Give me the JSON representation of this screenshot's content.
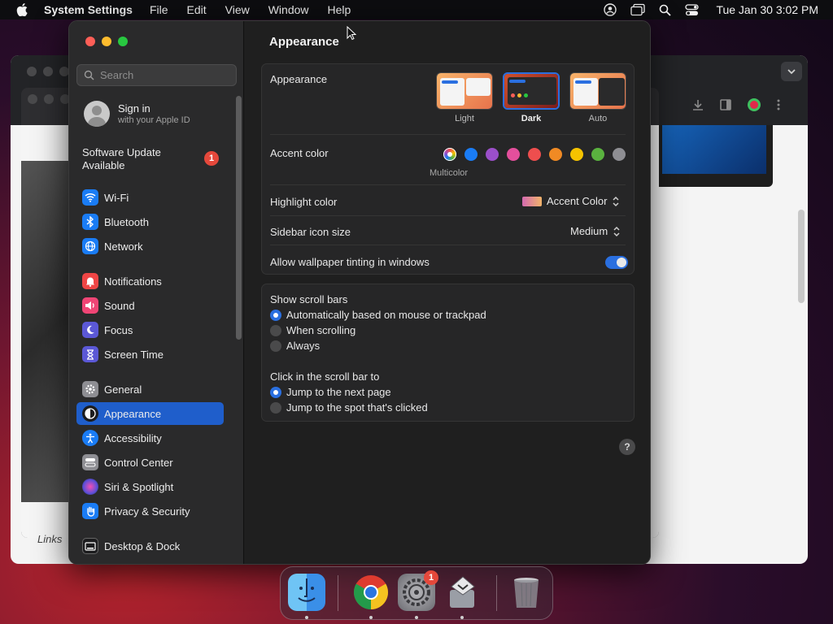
{
  "menubar": {
    "app_name": "System Settings",
    "menus": [
      "File",
      "Edit",
      "View",
      "Window",
      "Help"
    ],
    "clock": "Tue Jan 30  3:02 PM"
  },
  "background": {
    "links_text": "Links"
  },
  "sidebar": {
    "search_placeholder": "Search",
    "signin_title": "Sign in",
    "signin_subtitle": "with your Apple ID",
    "software_update_line1": "Software Update",
    "software_update_line2": "Available",
    "software_update_badge": "1",
    "items": [
      {
        "label": "Wi-Fi",
        "icon": "wifi-icon",
        "color": "#1a7cf5"
      },
      {
        "label": "Bluetooth",
        "icon": "bluetooth-icon",
        "color": "#1a7cf5"
      },
      {
        "label": "Network",
        "icon": "globe-icon",
        "color": "#1a7cf5"
      },
      {
        "label": "Notifications",
        "icon": "bell-icon",
        "color": "#ef4545"
      },
      {
        "label": "Sound",
        "icon": "speaker-icon",
        "color": "#ef4575"
      },
      {
        "label": "Focus",
        "icon": "moon-icon",
        "color": "#5b58d6"
      },
      {
        "label": "Screen Time",
        "icon": "hourglass-icon",
        "color": "#5b58d6"
      },
      {
        "label": "General",
        "icon": "gear-icon",
        "color": "#8e8e93"
      },
      {
        "label": "Appearance",
        "icon": "appearance-icon",
        "color": "#1c1c1e"
      },
      {
        "label": "Accessibility",
        "icon": "accessibility-icon",
        "color": "#1a7cf5"
      },
      {
        "label": "Control Center",
        "icon": "control-center-icon",
        "color": "#8e8e93"
      },
      {
        "label": "Siri & Spotlight",
        "icon": "siri-icon",
        "color": "#b44fd0"
      },
      {
        "label": "Privacy & Security",
        "icon": "hand-icon",
        "color": "#1a7cf5"
      },
      {
        "label": "Desktop & Dock",
        "icon": "desktop-icon",
        "color": "#1c1c1e"
      }
    ],
    "selected": "Appearance"
  },
  "main": {
    "title": "Appearance",
    "appearance_label": "Appearance",
    "appearance_options": [
      "Light",
      "Dark",
      "Auto"
    ],
    "appearance_selected": "Dark",
    "accent_label": "Accent color",
    "accent_colors": [
      "multicolor",
      "#1a7cf5",
      "#9b4fc9",
      "#e44f9c",
      "#ee4e4e",
      "#f08a24",
      "#f5c300",
      "#5ab23f",
      "#8e8e93"
    ],
    "accent_selected_caption": "Multicolor",
    "highlight_label": "Highlight color",
    "highlight_value": "Accent Color",
    "sidebar_icon_label": "Sidebar icon size",
    "sidebar_icon_value": "Medium",
    "wallpaper_tint_label": "Allow wallpaper tinting in windows",
    "wallpaper_tint_on": true,
    "scrollbars_label": "Show scroll bars",
    "scrollbars_options": [
      "Automatically based on mouse or trackpad",
      "When scrolling",
      "Always"
    ],
    "scrollbars_selected": 0,
    "click_label": "Click in the scroll bar to",
    "click_options": [
      "Jump to the next page",
      "Jump to the spot that's clicked"
    ],
    "click_selected": 0,
    "help": "?"
  },
  "dock": {
    "apps": [
      "Finder",
      "Google Chrome",
      "System Settings",
      "Migration Assistant",
      "Trash"
    ],
    "settings_badge": "1"
  }
}
